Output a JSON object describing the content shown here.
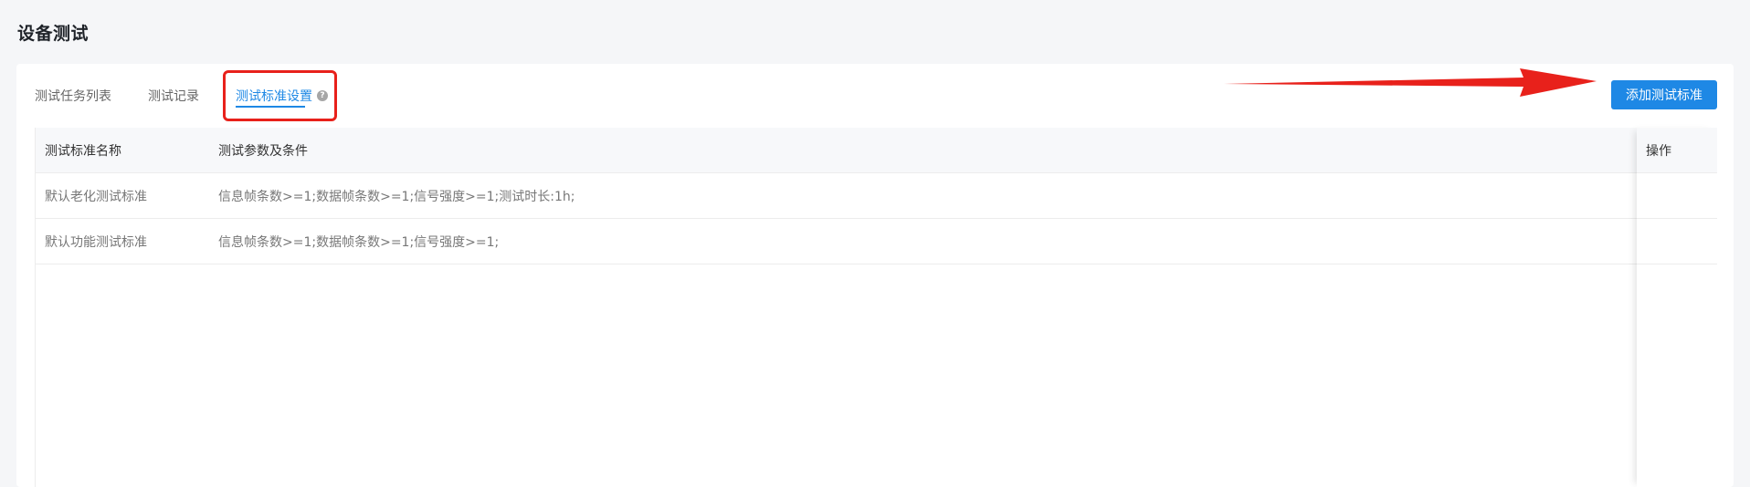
{
  "page": {
    "title": "设备测试"
  },
  "tabs": [
    {
      "label": "测试任务列表",
      "active": false
    },
    {
      "label": "测试记录",
      "active": false
    },
    {
      "label": "测试标准设置",
      "active": true
    }
  ],
  "help_icon": {
    "icon": "question-circle-icon",
    "glyph": "?"
  },
  "toolbar": {
    "add_label": "添加测试标准"
  },
  "table": {
    "columns": [
      "测试标准名称",
      "测试参数及条件",
      "操作"
    ],
    "rows": [
      {
        "name": "默认老化测试标准",
        "params": "信息帧条数>=1;数据帧条数>=1;信号强度>=1;测试时长:1h;"
      },
      {
        "name": "默认功能测试标准",
        "params": "信息帧条数>=1;数据帧条数>=1;信号强度>=1;"
      }
    ]
  },
  "colors": {
    "accent": "#1e88e5",
    "annotation": "#e8211b"
  }
}
